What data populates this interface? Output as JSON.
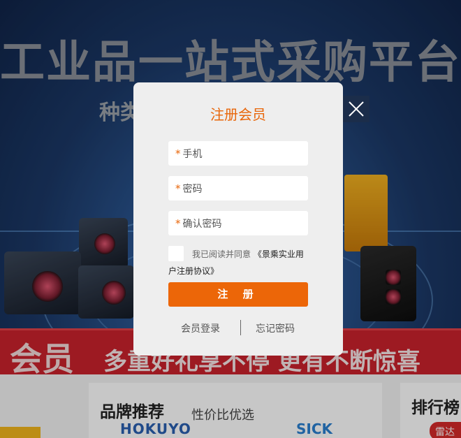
{
  "background": {
    "banner_title": "工业品一站式采购平台",
    "banner_subtitle": "种类",
    "promo_big": "会员",
    "promo_text": "多重好礼享不停 更有不断惊喜",
    "brand_section_title": "品牌推荐",
    "brand_section_sub": "性价比优选",
    "brands": [
      "HOKUYO",
      "SICK"
    ],
    "rank_section_title": "排行榜",
    "rank_tag": "雷达"
  },
  "modal": {
    "title": "注册会员",
    "required_mark": "*",
    "fields": {
      "phone": "手机",
      "password": "密码",
      "confirm_password": "确认密码"
    },
    "agree_prefix": "我已阅读并同意",
    "agree_link": "《景乘实业用户注册协议》",
    "submit_label": "注 册",
    "login_link": "会员登录",
    "forgot_link": "忘记密码"
  },
  "colors": {
    "accent": "#ec6608",
    "title": "#e8660a",
    "modal_bg": "#eeeeee"
  }
}
